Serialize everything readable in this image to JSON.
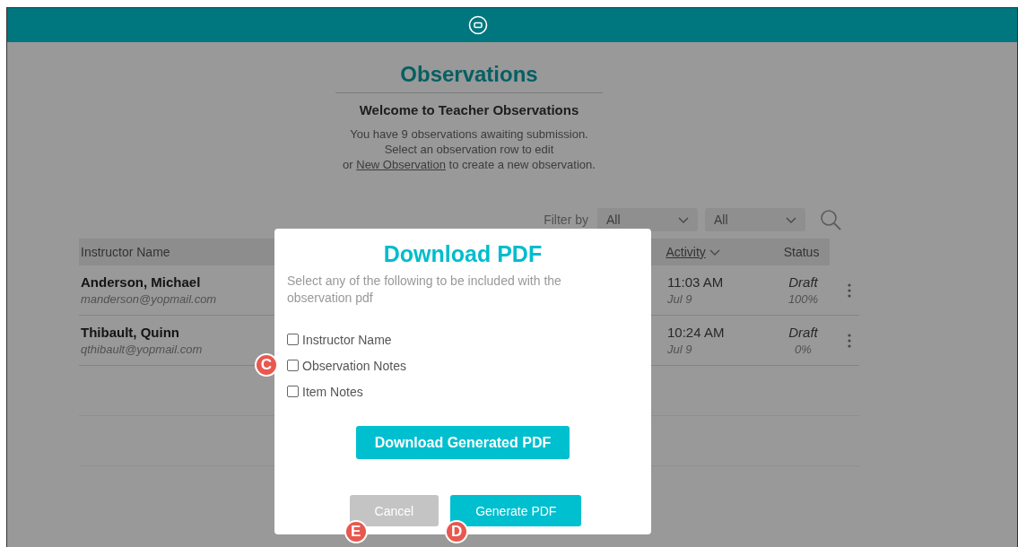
{
  "page": {
    "title": "Observations",
    "welcome": "Welcome to Teacher Observations",
    "intro": [
      "You have 9 observations awaiting submission.",
      "Select an observation row to edit"
    ],
    "intro_link_line": {
      "before": "or ",
      "link": "New Observation",
      "after": " to create a new observation."
    }
  },
  "filter": {
    "label": "Filter by",
    "selects": [
      {
        "value": "All"
      },
      {
        "value": "All"
      }
    ]
  },
  "table": {
    "columns": [
      {
        "label": "Instructor Name",
        "sorted": false
      },
      {
        "label": "Activity",
        "sorted": true
      },
      {
        "label": "Status",
        "sorted": false
      }
    ],
    "rows": [
      {
        "name": "Anderson, Michael",
        "email": "manderson@yopmail.com",
        "time": "11:03 AM",
        "date": "Jul 9",
        "status": "Draft",
        "progress": "100%"
      },
      {
        "name": "Thibault, Quinn",
        "email": "qthibault@yopmail.com",
        "time": "10:24 AM",
        "date": "Jul 9",
        "status": "Draft",
        "progress": "0%"
      }
    ]
  },
  "dialog": {
    "title": "Download PDF",
    "description": "Select any of the following to be included with the observation pdf",
    "options": [
      {
        "label": "Instructor Name",
        "checked": false
      },
      {
        "label": "Observation Notes",
        "checked": false,
        "callout": "C"
      },
      {
        "label": "Item Notes",
        "checked": false
      }
    ],
    "download_button": "Download Generated PDF",
    "buttons": [
      {
        "label": "Cancel",
        "disabled": true,
        "callout": "E"
      },
      {
        "label": "Generate PDF",
        "disabled": false,
        "callout": "D"
      }
    ]
  }
}
